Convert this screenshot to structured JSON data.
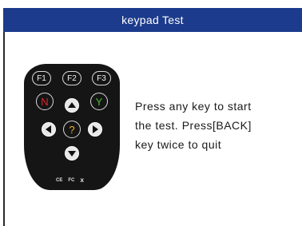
{
  "header": {
    "title": "keypad  Test"
  },
  "keypad": {
    "f1": "F1",
    "f2": "F2",
    "f3": "F3",
    "n": "N",
    "y": "Y",
    "help": "?",
    "marks": [
      "CE",
      "FC",
      "Ⅹ"
    ],
    "colors": {
      "n": "#e0242a",
      "y": "#4cbf34",
      "help": "#f2b21b"
    }
  },
  "message": {
    "line1": "Press any key to start",
    "line2": "the test. Press[BACK]",
    "line3": "key twice to quit"
  }
}
